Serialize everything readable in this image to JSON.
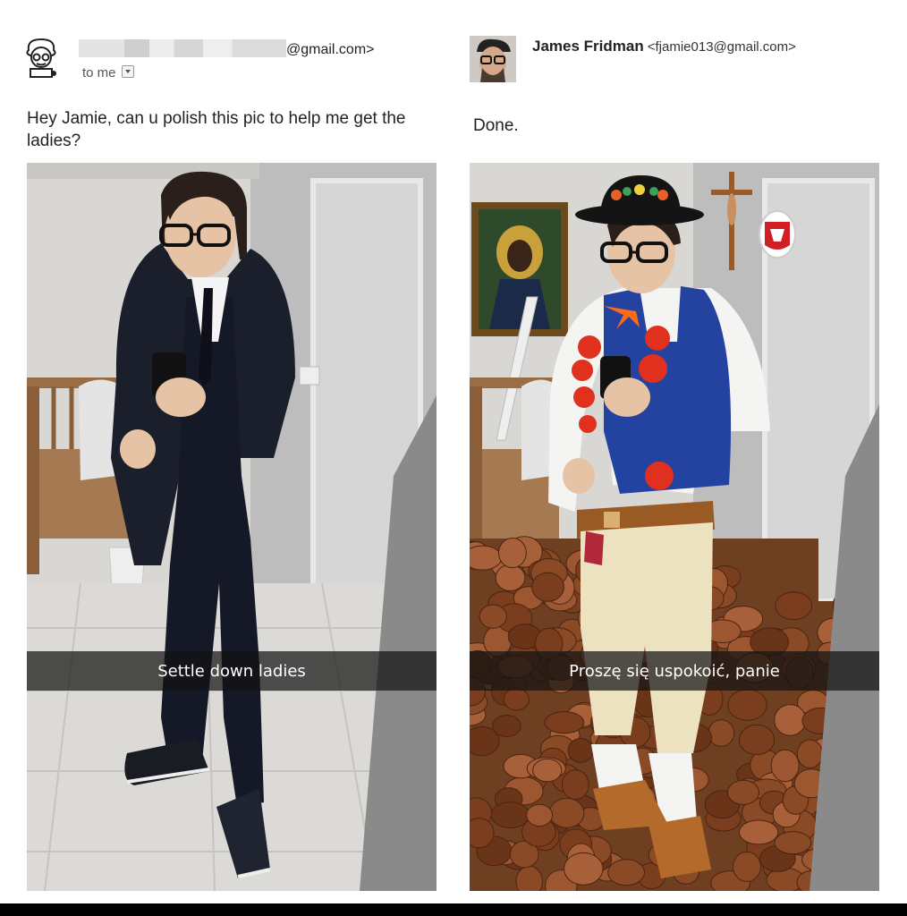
{
  "left": {
    "sender_email_suffix": "@gmail.com>",
    "recipient": "to me",
    "message": "Hey Jamie, can u polish this pic to help me get the ladies?",
    "photo_caption": "Settle down ladies"
  },
  "right": {
    "sender_name": "James Fridman",
    "sender_email": "<fjamie013@gmail.com>",
    "message": "Done.",
    "photo_caption": "Proszę się uspokoić, panie"
  }
}
